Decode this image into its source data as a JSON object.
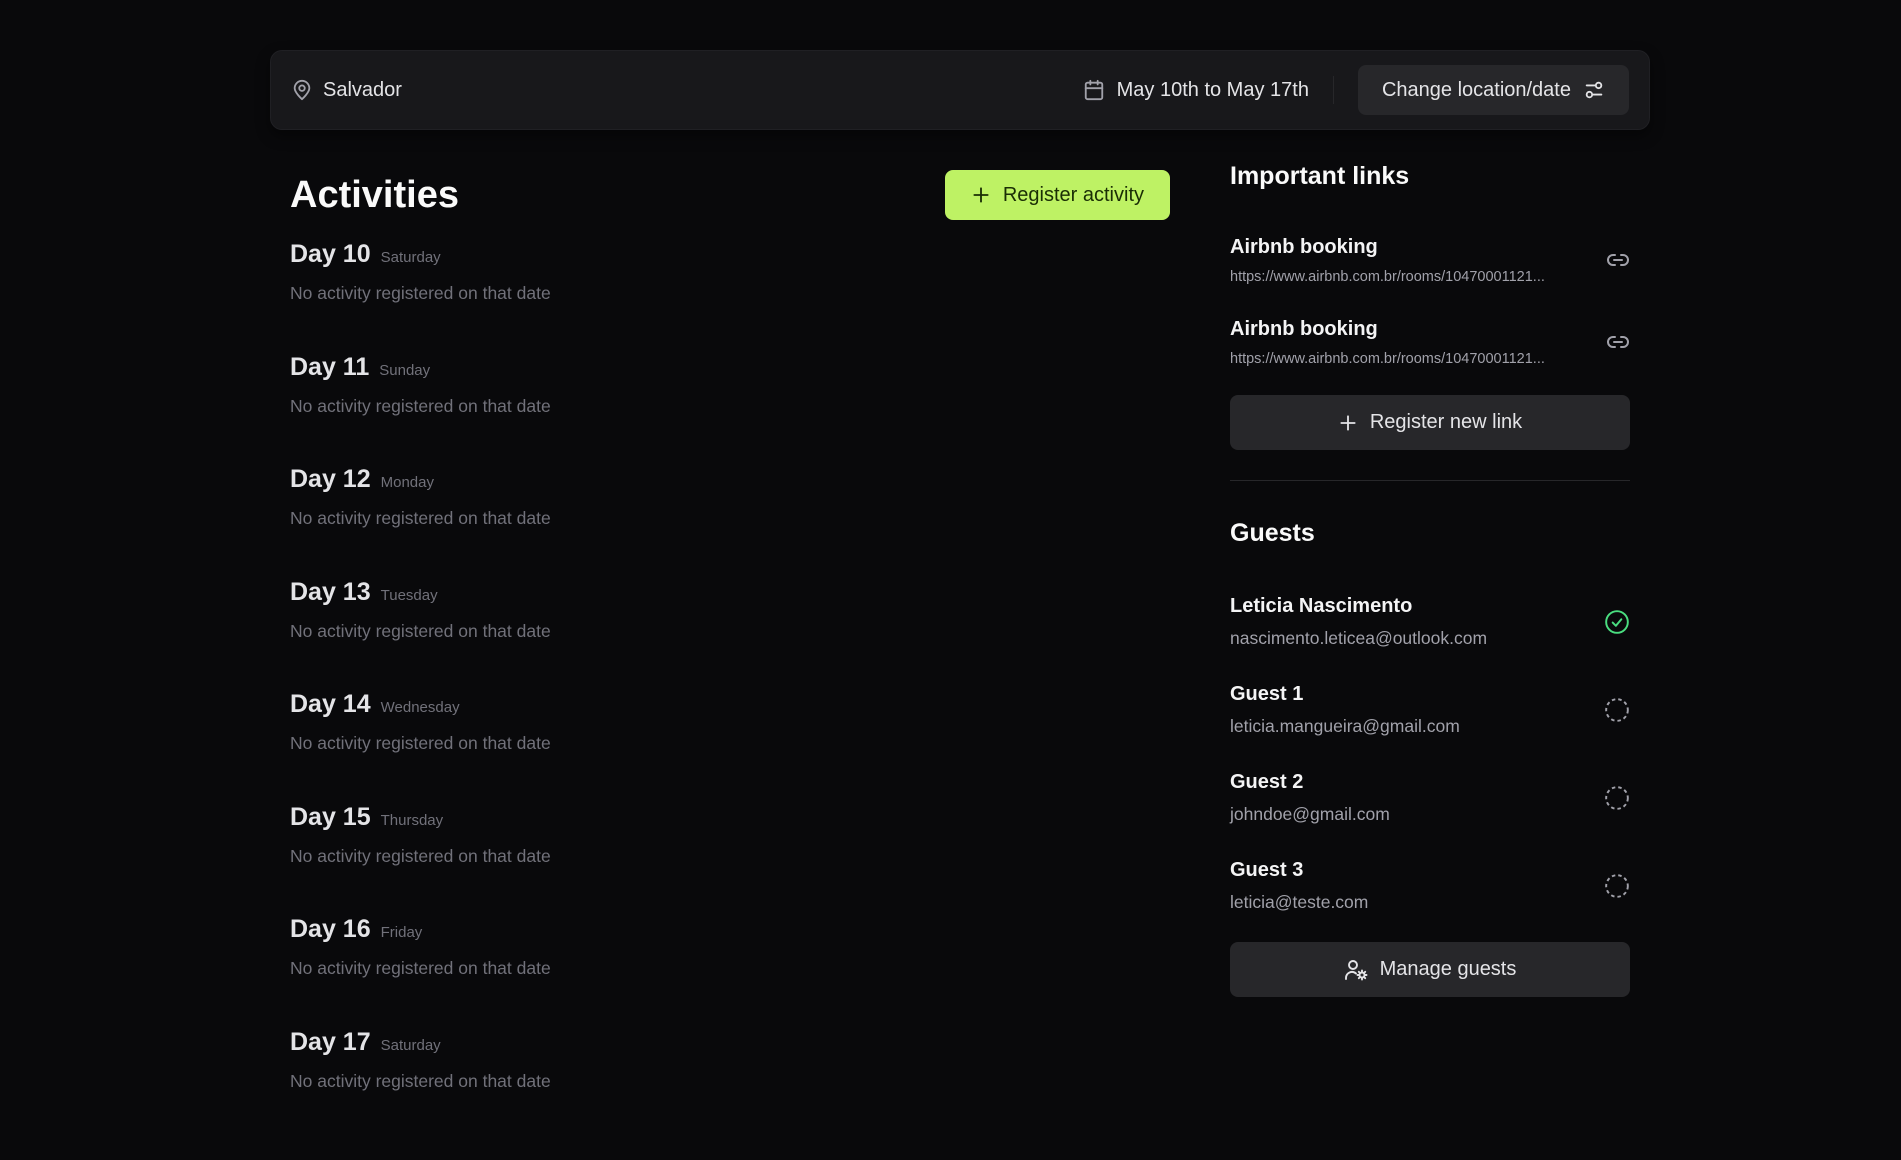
{
  "header": {
    "location": "Salvador",
    "dates": "May 10th to May 17th",
    "change_button": "Change location/date"
  },
  "activities": {
    "title": "Activities",
    "register_button": "Register activity",
    "days": [
      {
        "title": "Day 10",
        "weekday": "Saturday",
        "empty": "No activity registered on that date"
      },
      {
        "title": "Day 11",
        "weekday": "Sunday",
        "empty": "No activity registered on that date"
      },
      {
        "title": "Day 12",
        "weekday": "Monday",
        "empty": "No activity registered on that date"
      },
      {
        "title": "Day 13",
        "weekday": "Tuesday",
        "empty": "No activity registered on that date"
      },
      {
        "title": "Day 14",
        "weekday": "Wednesday",
        "empty": "No activity registered on that date"
      },
      {
        "title": "Day 15",
        "weekday": "Thursday",
        "empty": "No activity registered on that date"
      },
      {
        "title": "Day 16",
        "weekday": "Friday",
        "empty": "No activity registered on that date"
      },
      {
        "title": "Day 17",
        "weekday": "Saturday",
        "empty": "No activity registered on that date"
      }
    ]
  },
  "links": {
    "title": "Important links",
    "items": [
      {
        "name": "Airbnb booking",
        "url": "https://www.airbnb.com.br/rooms/10470001121..."
      },
      {
        "name": "Airbnb booking",
        "url": "https://www.airbnb.com.br/rooms/10470001121..."
      }
    ],
    "register_button": "Register new link"
  },
  "guests": {
    "title": "Guests",
    "items": [
      {
        "name": "Leticia Nascimento",
        "email": "nascimento.leticea@outlook.com",
        "status": "confirmed",
        "status_icon": "circle-check-icon",
        "status_color": "#4ade80"
      },
      {
        "name": "Guest 1",
        "email": "leticia.mangueira@gmail.com",
        "status": "pending",
        "status_icon": "circle-dashed-icon",
        "status_color": "#a1a1aa"
      },
      {
        "name": "Guest 2",
        "email": "johndoe@gmail.com",
        "status": "pending",
        "status_icon": "circle-dashed-icon",
        "status_color": "#a1a1aa"
      },
      {
        "name": "Guest 3",
        "email": "leticia@teste.com",
        "status": "pending",
        "status_icon": "circle-dashed-icon",
        "status_color": "#a1a1aa"
      }
    ],
    "manage_button": "Manage guests"
  },
  "colors": {
    "background": "#09090b",
    "surface": "#18181b",
    "secondary_button": "#27272a",
    "accent": "#bef264",
    "accent_text": "#1a2e05",
    "confirmed": "#4ade80"
  }
}
